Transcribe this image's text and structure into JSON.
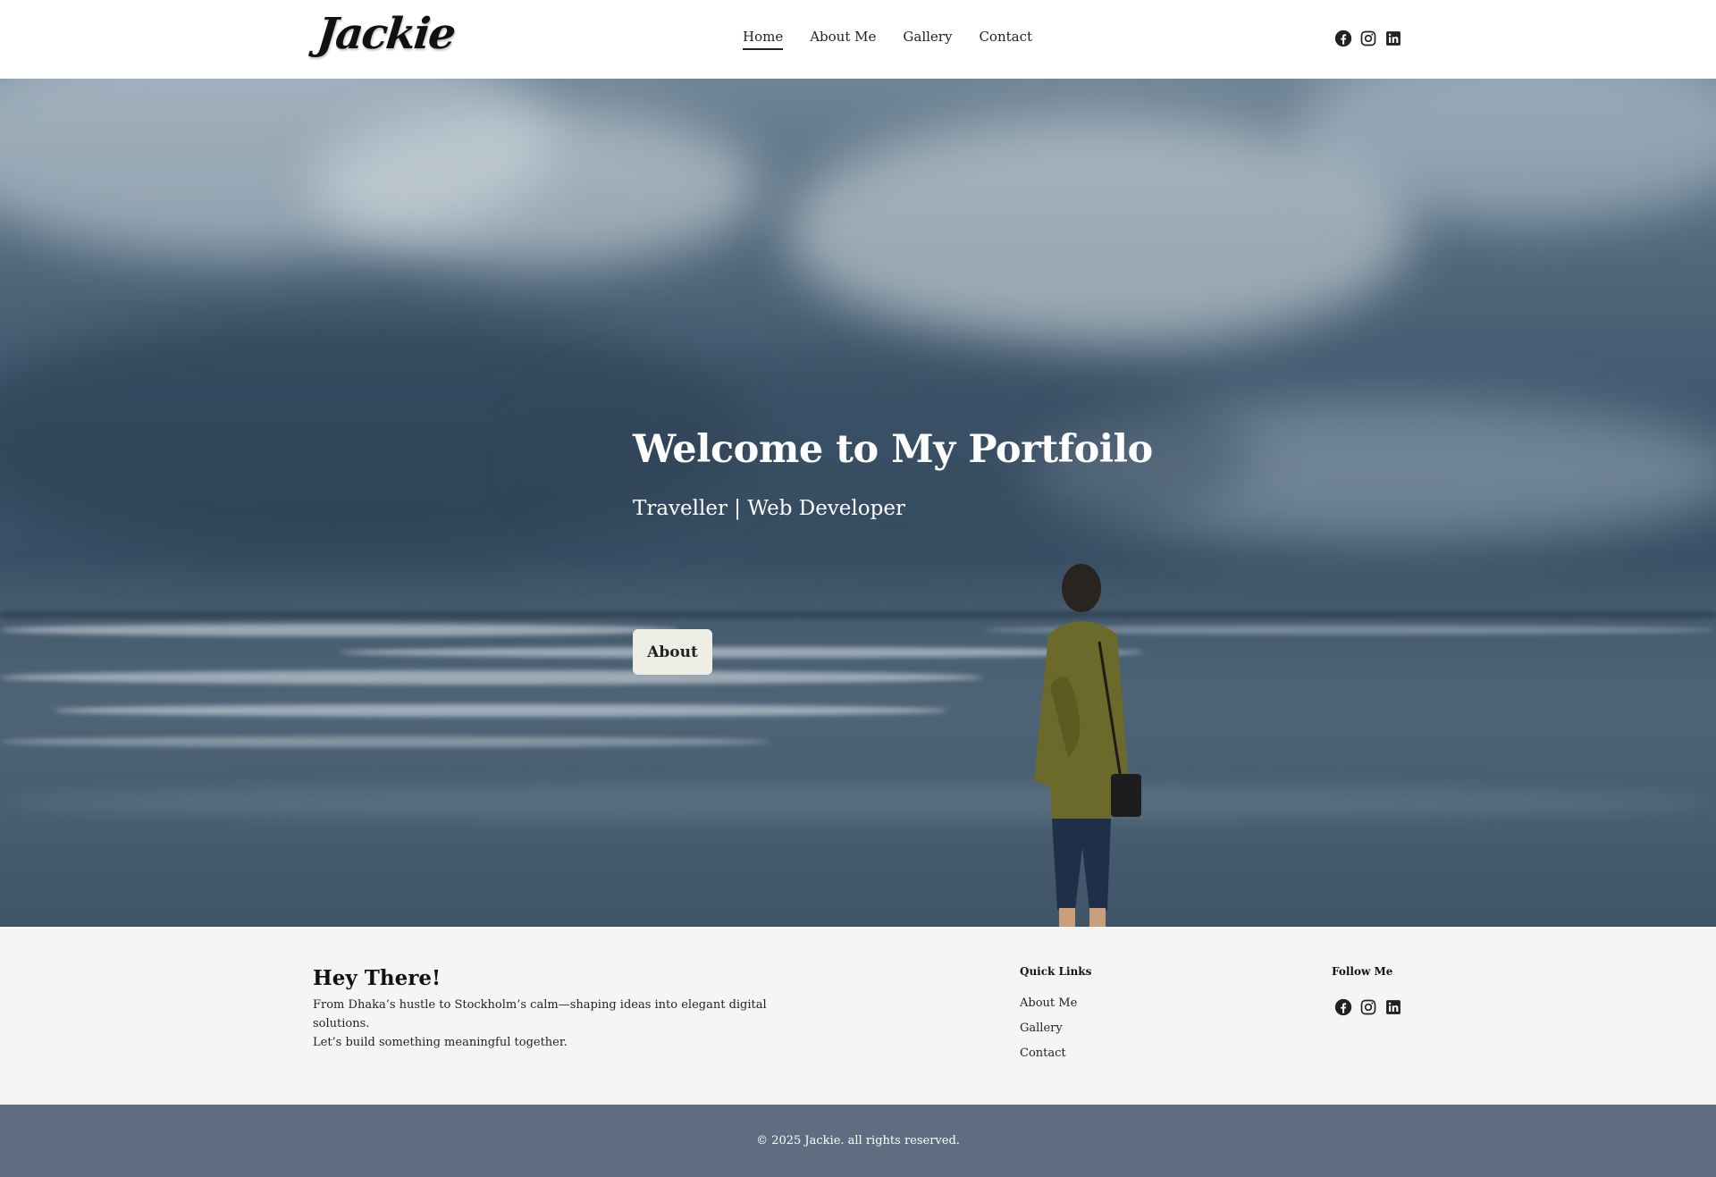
{
  "header": {
    "logo": "Jackie",
    "nav": [
      {
        "label": "Home",
        "active": true
      },
      {
        "label": "About Me",
        "active": false
      },
      {
        "label": "Gallery",
        "active": false
      },
      {
        "label": "Contact",
        "active": false
      }
    ],
    "social_icons": [
      "facebook-icon",
      "instagram-icon",
      "linkedin-icon"
    ]
  },
  "hero": {
    "title": "Welcome to My Portfoilo",
    "subtitle": "Traveller | Web Developer",
    "button_label": "About"
  },
  "footer": {
    "heading": "Hey There!",
    "text_line1": "From Dhaka’s hustle to Stockholm’s calm—shaping ideas into elegant digital solutions.",
    "text_line2": "Let’s build something meaningful together.",
    "quick_links_heading": "Quick Links",
    "quick_links": [
      "About Me",
      "Gallery",
      "Contact"
    ],
    "follow_heading": "Follow Me",
    "copyright": "© 2025 Jackie. all rights reserved."
  },
  "colors": {
    "header_bg": "#ffffff",
    "footer_bg": "#f5f5f5",
    "bottom_bar_bg": "#5e6d80",
    "button_bg": "#eeeee4",
    "text_dark": "#222222"
  }
}
